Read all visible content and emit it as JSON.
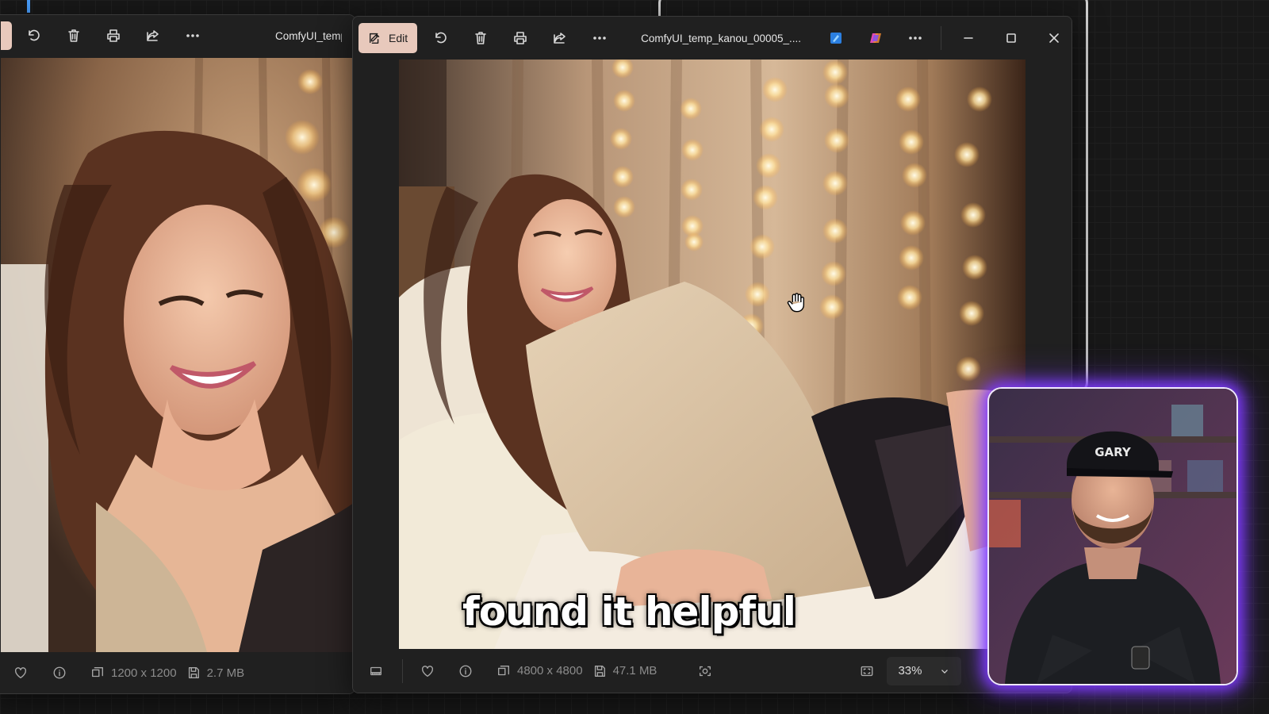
{
  "left_window": {
    "title": "ComfyUI_temp",
    "dimensions": "1200 x 1200",
    "file_size": "2.7 MB"
  },
  "main_window": {
    "edit_label": "Edit",
    "title": "ComfyUI_temp_kanou_00005_....",
    "dimensions": "4800 x 4800",
    "file_size": "47.1 MB",
    "zoom": "33%"
  },
  "caption": "found it helpful",
  "webcam": {
    "cap_text": "GARY"
  },
  "icons": {
    "rotate": "rotate-icon",
    "delete": "trash-icon",
    "print": "print-icon",
    "share": "share-icon",
    "more": "more-icon",
    "favorite": "heart-icon",
    "info": "info-icon",
    "resolution": "image-size-icon",
    "storage": "disk-icon",
    "filmstrip": "filmstrip-icon",
    "face-detect": "face-scan-icon",
    "fit": "fit-screen-icon",
    "designer": "designer-icon",
    "copilot": "copilot-icon"
  },
  "colors": {
    "edit_accent": "#e8c9bc",
    "webcam_glow": "#7f3bff",
    "window_bg": "#202020"
  }
}
